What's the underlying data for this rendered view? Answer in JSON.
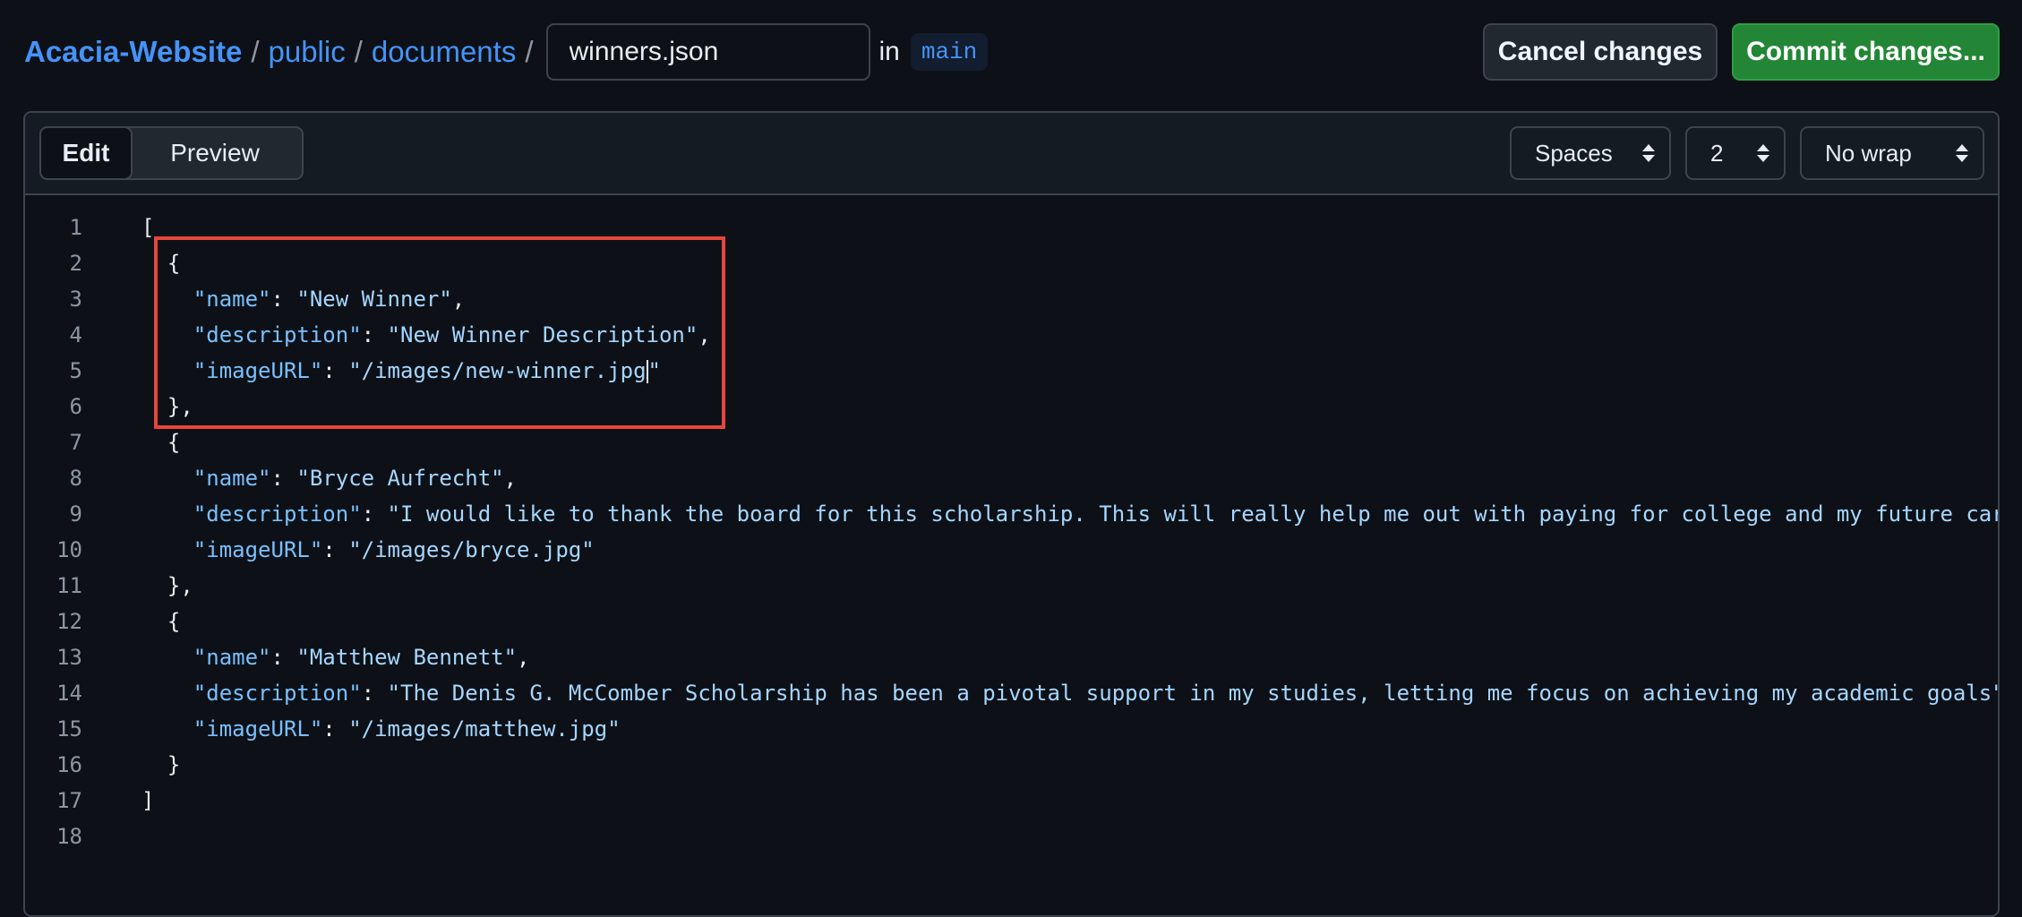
{
  "breadcrumb": {
    "repo": "Acacia-Website",
    "folder1": "public",
    "folder2": "documents",
    "separator": "/",
    "filename": "winners.json",
    "in_label": "in",
    "branch": "main"
  },
  "actions": {
    "cancel_label": "Cancel changes",
    "commit_label": "Commit changes..."
  },
  "editor": {
    "tabs": {
      "edit": "Edit",
      "preview": "Preview"
    },
    "indent_mode": "Spaces",
    "indent_size": "2",
    "wrap_mode": "No wrap"
  },
  "code_lines": [
    {
      "n": "1",
      "indent": "",
      "key": "",
      "value": "",
      "text": "["
    },
    {
      "n": "2",
      "indent": "  ",
      "key": "",
      "value": "",
      "text": "{"
    },
    {
      "n": "3",
      "indent": "    ",
      "key": "\"name\"",
      "value": "\"New Winner\"",
      "tail": ","
    },
    {
      "n": "4",
      "indent": "    ",
      "key": "\"description\"",
      "value": "\"New Winner Description\"",
      "tail": ","
    },
    {
      "n": "5",
      "indent": "    ",
      "key": "\"imageURL\"",
      "value_a": "\"/images/new-winner.jpg",
      "value_b": "\"",
      "tail": ""
    },
    {
      "n": "6",
      "indent": "  ",
      "text": "},"
    },
    {
      "n": "7",
      "indent": "  ",
      "text": "{"
    },
    {
      "n": "8",
      "indent": "    ",
      "key": "\"name\"",
      "value": "\"Bryce Aufrecht\"",
      "tail": ","
    },
    {
      "n": "9",
      "indent": "    ",
      "key": "\"description\"",
      "value": "\"I would like to thank the board for this scholarship. This will really help me out with paying for college and my future car",
      "tail": ""
    },
    {
      "n": "10",
      "indent": "    ",
      "key": "\"imageURL\"",
      "value": "\"/images/bryce.jpg\"",
      "tail": ""
    },
    {
      "n": "11",
      "indent": "  ",
      "text": "},"
    },
    {
      "n": "12",
      "indent": "  ",
      "text": "{"
    },
    {
      "n": "13",
      "indent": "    ",
      "key": "\"name\"",
      "value": "\"Matthew Bennett\"",
      "tail": ","
    },
    {
      "n": "14",
      "indent": "    ",
      "key": "\"description\"",
      "value": "\"The Denis G. McComber Scholarship has been a pivotal support in my studies, letting me focus on achieving my academic goals\"",
      "tail": ""
    },
    {
      "n": "15",
      "indent": "    ",
      "key": "\"imageURL\"",
      "value": "\"/images/matthew.jpg\"",
      "tail": ""
    },
    {
      "n": "16",
      "indent": "  ",
      "text": "}"
    },
    {
      "n": "17",
      "indent": "",
      "text": "]"
    },
    {
      "n": "18",
      "indent": "",
      "text": ""
    }
  ],
  "colors": {
    "background": "#0d1117",
    "link": "#4493f8",
    "commit_button": "#238636",
    "json_key": "#79c0ff",
    "json_string": "#a5d6ff",
    "highlight_box": "#e8453c"
  }
}
